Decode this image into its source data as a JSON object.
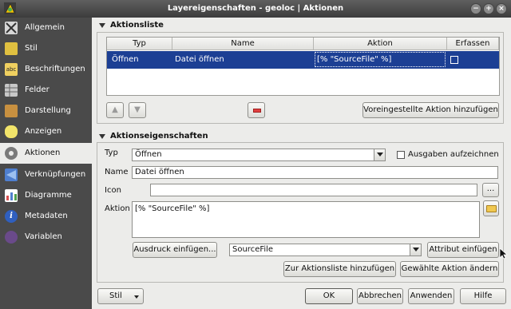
{
  "window": {
    "title": "Layereigenschaften - geoloc | Aktionen",
    "btn_min": "−",
    "btn_max": "+",
    "btn_close": "×"
  },
  "sidebar": {
    "items": [
      {
        "label": "Allgemein",
        "icon": "tools-icon",
        "color": "#d6d6d6"
      },
      {
        "label": "Stil",
        "icon": "brush-icon",
        "color": "#e0c040"
      },
      {
        "label": "Beschriftungen",
        "icon": "abc-label-icon",
        "color": "#f0d060"
      },
      {
        "label": "Felder",
        "icon": "table-icon",
        "color": "#c8c8c8"
      },
      {
        "label": "Darstellung",
        "icon": "paint-icon",
        "color": "#c89040"
      },
      {
        "label": "Anzeigen",
        "icon": "speech-bubble-icon",
        "color": "#f2e46a"
      },
      {
        "label": "Aktionen",
        "icon": "gear-icon",
        "color": "#7a7a7a"
      },
      {
        "label": "Verknüpfungen",
        "icon": "join-icon",
        "color": "#4f7fcf"
      },
      {
        "label": "Diagramme",
        "icon": "diagram-icon",
        "color": "#d85050"
      },
      {
        "label": "Metadaten",
        "icon": "info-icon",
        "color": "#2f5fbf"
      },
      {
        "label": "Variablen",
        "icon": "variables-icon",
        "color": "#6a4a8a"
      }
    ],
    "active_index": 6
  },
  "actions_list": {
    "title": "Aktionsliste",
    "columns": [
      "Typ",
      "Name",
      "Aktion",
      "Erfassen"
    ],
    "rows": [
      {
        "typ": "Öffnen",
        "name": "Datei öffnen",
        "aktion": "[% \"SourceFile\" %]",
        "erfassen": false
      }
    ],
    "btn_up": "▲",
    "btn_down": "▼",
    "btn_default": "Voreingestellte Aktion hinzufügen"
  },
  "action_props": {
    "title": "Aktionseigenschaften",
    "typ_label": "Typ",
    "typ_value": "Öffnen",
    "capture_label": "Ausgaben aufzeichnen",
    "name_label": "Name",
    "name_value": "Datei öffnen",
    "icon_label": "Icon",
    "icon_value": "",
    "icon_btn": "...",
    "aktion_label": "Aktion",
    "aktion_value": "[% \"SourceFile\" %]",
    "expr_btn": "Ausdruck einfügen...",
    "attr_value": "SourceFile",
    "attr_btn": "Attribut einfügen",
    "add_btn": "Zur Aktionsliste hinzufügen",
    "change_btn": "Gewählte Aktion ändern"
  },
  "footer": {
    "stil": "Stil",
    "ok": "OK",
    "cancel": "Abbrechen",
    "apply": "Anwenden",
    "help": "Hilfe"
  }
}
